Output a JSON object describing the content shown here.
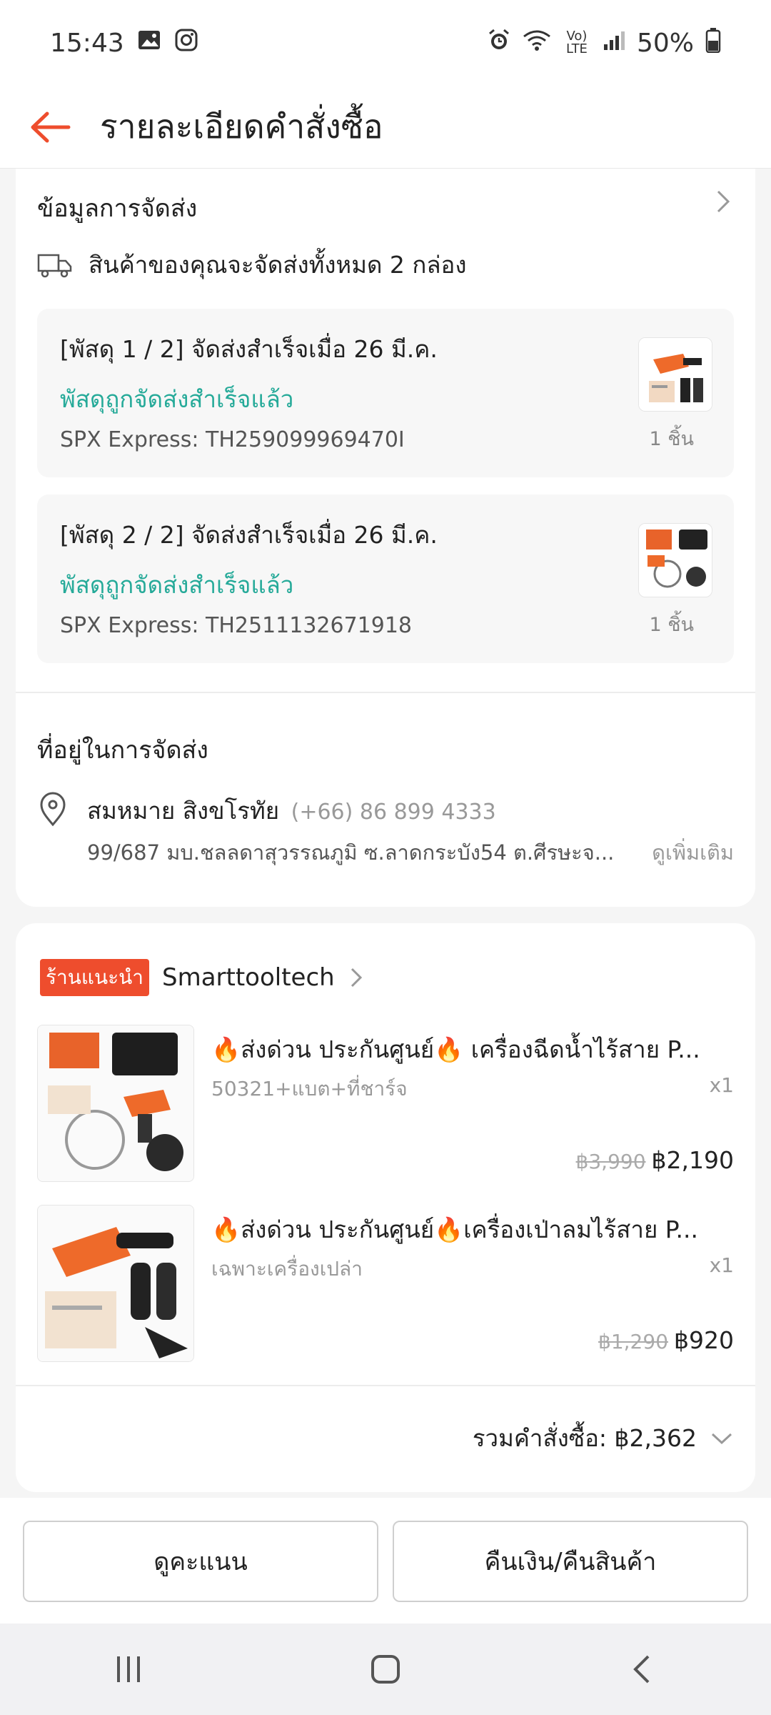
{
  "status_bar": {
    "time": "15:43",
    "battery": "50%",
    "network": "Vo) LTE"
  },
  "header": {
    "title": "รายละเอียดคำสั่งซื้อ"
  },
  "shipping": {
    "section_title": "ข้อมูลการจัดส่ง",
    "summary": "สินค้าของคุณจะจัดส่งทั้งหมด 2 กล่อง",
    "parcels": [
      {
        "title": "[พัสดุ 1 / 2] จัดส่งสำเร็จเมื่อ 26 มี.ค.",
        "status": "พัสดุถูกจัดส่งสำเร็จแล้ว",
        "tracking": "SPX Express: TH259099969470I",
        "qty": "1 ชิ้น"
      },
      {
        "title": "[พัสดุ 2 / 2] จัดส่งสำเร็จเมื่อ 26 มี.ค.",
        "status": "พัสดุถูกจัดส่งสำเร็จแล้ว",
        "tracking": "SPX Express: TH2511132671918",
        "qty": "1 ชิ้น"
      }
    ]
  },
  "address": {
    "section_title": "ที่อยู่ในการจัดส่ง",
    "name": "สมหมาย สิงขโรทัย",
    "phone": "(+66) 86 899 4333",
    "line": "99/687 มบ.ชลลดาสุวรรณภูมิ ซ.ลาดกระบัง54 ต.ศีรษะจ...",
    "see_more": "ดูเพิ่มเติม"
  },
  "shop": {
    "badge": "ร้านแนะนำ",
    "name": "Smarttooltech"
  },
  "items": [
    {
      "title": "🔥ส่งด่วน ประกันศูนย์🔥 เครื่องฉีดน้ำไร้สาย P...",
      "variant": "50321+แบต+ที่ชาร์จ",
      "qty": "x1",
      "original_price": "฿3,990",
      "price": "฿2,190"
    },
    {
      "title": "🔥ส่งด่วน ประกันศูนย์🔥เครื่องเป่าลมไร้สาย P...",
      "variant": "เฉพาะเครื่องเปล่า",
      "qty": "x1",
      "original_price": "฿1,290",
      "price": "฿920"
    }
  ],
  "order_total": {
    "label": "รวมคำสั่งซื้อ: ฿2,362"
  },
  "actions": {
    "rate_label": "ดูคะแนน",
    "refund_label": "คืนเงิน/คืนสินค้า"
  },
  "colors": {
    "accent": "#ee4d2d",
    "success": "#26aa99"
  }
}
